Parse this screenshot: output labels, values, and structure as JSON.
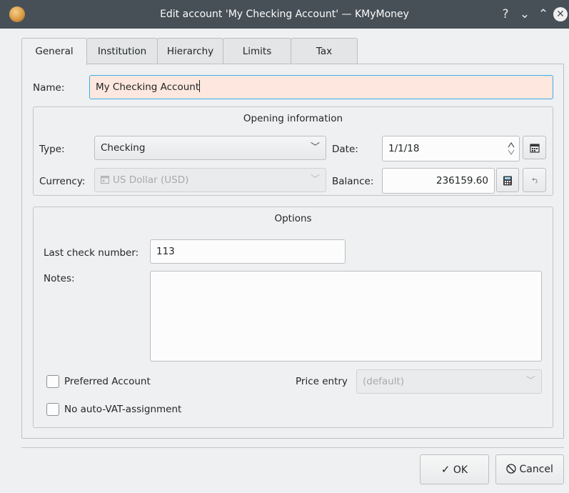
{
  "window": {
    "title": "Edit account 'My Checking Account' — KMyMoney",
    "help_glyph": "?",
    "minimize_glyph": "⌄",
    "maximize_glyph": "⌃",
    "close_glyph": "✕"
  },
  "tabs": [
    {
      "label": "General",
      "active": true
    },
    {
      "label": "Institution",
      "active": false
    },
    {
      "label": "Hierarchy",
      "active": false
    },
    {
      "label": "Limits",
      "active": false
    },
    {
      "label": "Tax",
      "active": false
    }
  ],
  "general": {
    "name_label": "Name:",
    "name_value": "My Checking Account",
    "opening": {
      "title": "Opening information",
      "type_label": "Type:",
      "type_value": "Checking",
      "date_label": "Date:",
      "date_value": "1/1/18",
      "currency_label": "Currency:",
      "currency_value": "US Dollar (USD)",
      "balance_label": "Balance:",
      "balance_value": "236159.60"
    },
    "options": {
      "title": "Options",
      "last_check_label": "Last check number:",
      "last_check_value": "113",
      "notes_label": "Notes:",
      "notes_value": "",
      "preferred_label": "Preferred Account",
      "preferred_checked": false,
      "price_entry_label": "Price entry",
      "price_entry_value": "(default)",
      "no_vat_label": "No auto-VAT-assignment",
      "no_vat_checked": false
    }
  },
  "buttons": {
    "ok_label": "OK",
    "cancel_label": "Cancel"
  }
}
